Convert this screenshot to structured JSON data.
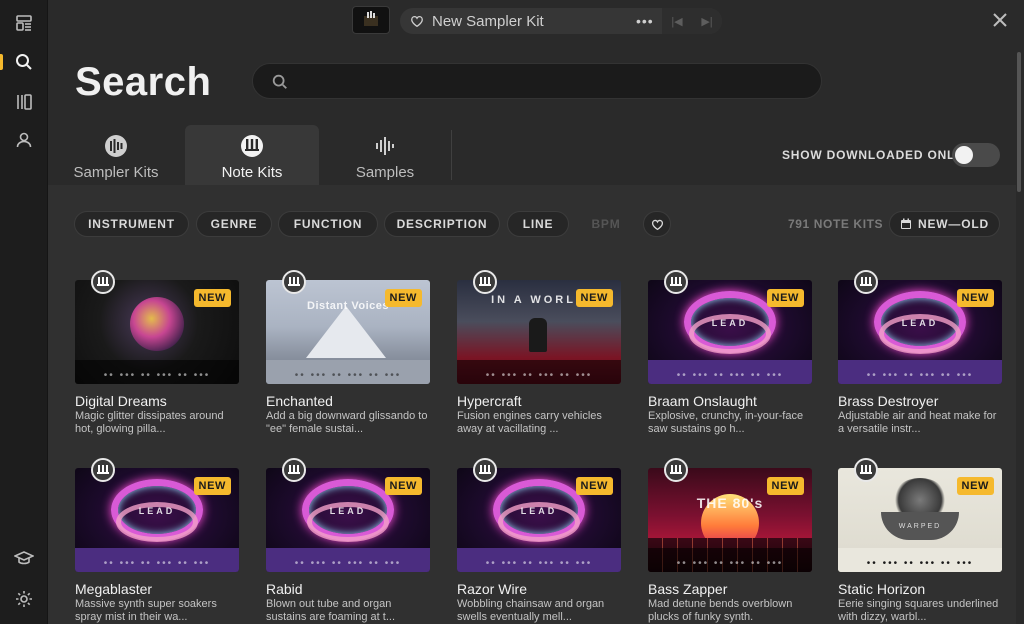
{
  "topbar": {
    "kit_name": "New Sampler Kit",
    "more_label": "•••"
  },
  "page_title": "Search",
  "search": {
    "placeholder": "",
    "value": ""
  },
  "tabs": [
    {
      "label": "Sampler Kits",
      "icon": "sampler-kit-icon",
      "active": false
    },
    {
      "label": "Note Kits",
      "icon": "note-kit-icon",
      "active": true
    },
    {
      "label": "Samples",
      "icon": "waveform-icon",
      "active": false
    }
  ],
  "show_downloaded_label": "SHOW DOWNLOADED ONLY",
  "show_downloaded_on": false,
  "filters": [
    "INSTRUMENT",
    "GENRE",
    "FUNCTION",
    "DESCRIPTION",
    "LINE",
    "BPM"
  ],
  "result_count": "791 NOTE KITS",
  "sort_label": "NEW—OLD",
  "badge_label": "NEW",
  "cards": [
    {
      "title": "Digital Dreams",
      "desc": "Magic glitter dissipates around hot, glowing pilla...",
      "art_text": ""
    },
    {
      "title": "Enchanted",
      "desc": "Add a big downward glissando to \"ee\" female sustai...",
      "art_text": "Distant Voices"
    },
    {
      "title": "Hypercraft",
      "desc": "Fusion engines carry vehicles away at vacillating ...",
      "art_text": "IN A WORLD"
    },
    {
      "title": "Braam Onslaught",
      "desc": "Explosive, crunchy, in-your-face saw sustains go h...",
      "art_text": "LEAD"
    },
    {
      "title": "Brass Destroyer",
      "desc": "Adjustable air and heat make for a versatile instr...",
      "art_text": "LEAD"
    },
    {
      "title": "Megablaster",
      "desc": "Massive synth super soakers spray mist in their wa...",
      "art_text": "LEAD"
    },
    {
      "title": "Rabid",
      "desc": "Blown out tube and organ sustains are foaming at t...",
      "art_text": "LEAD"
    },
    {
      "title": "Razor Wire",
      "desc": "Wobbling chainsaw and organ swells eventually mell...",
      "art_text": "LEAD"
    },
    {
      "title": "Bass Zapper",
      "desc": "Mad detune bends overblown plucks of funky synth.",
      "art_text": "THE 80's"
    },
    {
      "title": "Static Horizon",
      "desc": "Eerie singing squares underlined with dizzy, warbl...",
      "art_text": "WARPED"
    }
  ],
  "dots_pattern": "•• ••• •• ••• •• •••",
  "colors": {
    "accent": "#f5b92d",
    "purple_strip": "#4b2d80",
    "background": "#2a2a2a"
  }
}
